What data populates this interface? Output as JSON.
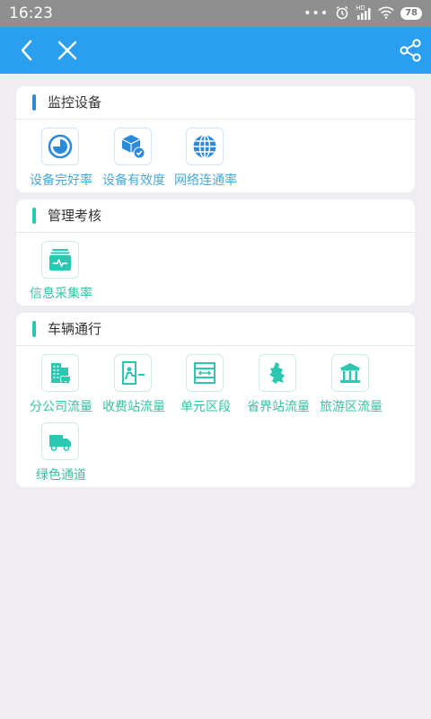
{
  "status_bar": {
    "time": "16:23",
    "signal_label": "HD",
    "battery": "78",
    "icons": [
      "more-dots-icon",
      "alarm-icon",
      "signal-icon",
      "wifi-icon",
      "battery-icon"
    ]
  },
  "app_bar": {
    "back_icon": "chevron-left-icon",
    "close_icon": "close-icon",
    "share_icon": "share-icon",
    "background_color": "#2a9fef"
  },
  "sections": [
    {
      "title": "监控设备",
      "accent_color": "#2a8bdc",
      "items": [
        {
          "label": "设备完好率",
          "icon": "pie-gauge-icon"
        },
        {
          "label": "设备有效度",
          "icon": "cube-check-icon"
        },
        {
          "label": "网络连通率",
          "icon": "globe-icon"
        }
      ]
    },
    {
      "title": "管理考核",
      "accent_color": "#2bc7b0",
      "items": [
        {
          "label": "信息采集率",
          "icon": "data-tray-icon"
        }
      ]
    },
    {
      "title": "车辆通行",
      "accent_color": "#2bc7b0",
      "items": [
        {
          "label": "分公司流量",
          "icon": "office-building-icon"
        },
        {
          "label": "收费站流量",
          "icon": "toll-booth-icon"
        },
        {
          "label": "单元区段",
          "icon": "road-segment-icon"
        },
        {
          "label": "省界站流量",
          "icon": "province-map-icon"
        },
        {
          "label": "旅游区流量",
          "icon": "pavilion-icon"
        },
        {
          "label": "绿色通道",
          "icon": "truck-icon"
        }
      ]
    }
  ]
}
